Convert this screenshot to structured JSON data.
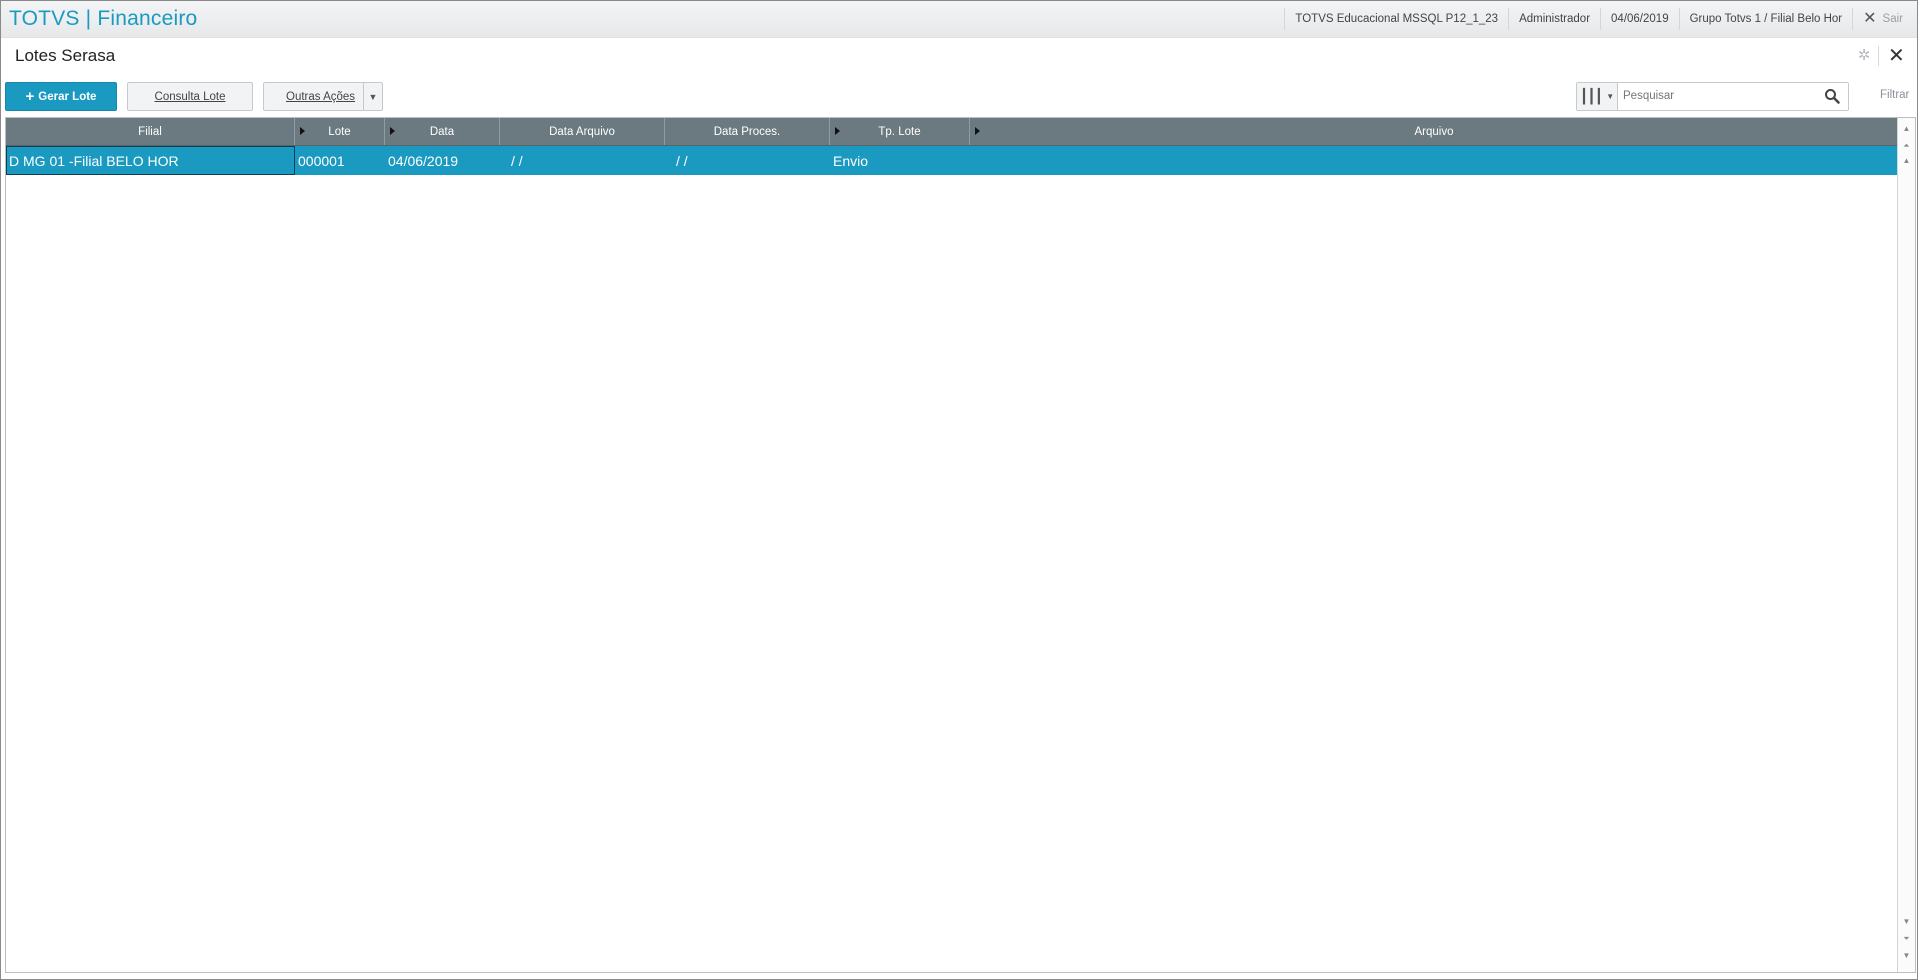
{
  "app": {
    "title": "TOTVS | Financeiro"
  },
  "topbar": {
    "environment": "TOTVS Educacional MSSQL P12_1_23",
    "user": "Administrador",
    "date": "04/06/2019",
    "branch": "Grupo Totvs 1 / Filial Belo Hor",
    "exit_label": "Sair"
  },
  "page": {
    "title": "Lotes Serasa"
  },
  "toolbar": {
    "primary_label": "Gerar Lote",
    "consulta_label": "Consulta Lote",
    "outras_label": "Outras Ações",
    "filter_label": "Filtrar",
    "search_placeholder": "Pesquisar"
  },
  "grid": {
    "columns": [
      "Filial",
      "Lote",
      "Data",
      "Data Arquivo",
      "Data Proces.",
      "Tp. Lote",
      "Arquivo"
    ],
    "rows": [
      {
        "filial": "D MG 01 -Filial BELO HOR",
        "lote": "000001",
        "data": "04/06/2019",
        "data_arquivo": "/  /",
        "data_proces": "/  /",
        "tp_lote": "Envio",
        "arquivo": ""
      }
    ]
  },
  "colors": {
    "accent": "#1a9ac0",
    "header_bg": "#6b7a80"
  }
}
